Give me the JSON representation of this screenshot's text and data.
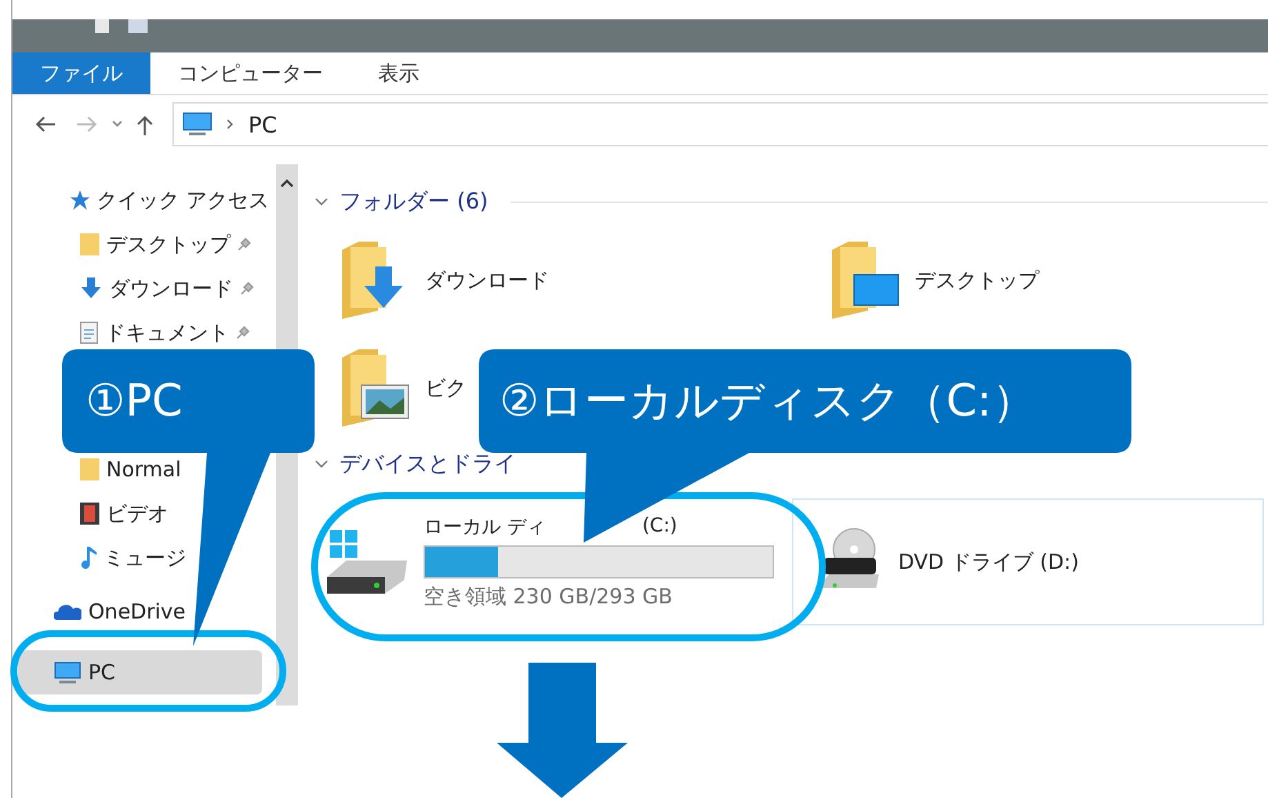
{
  "tabs": [
    {
      "label": "ファイル",
      "selected": true
    },
    {
      "label": "コンピューター",
      "selected": false
    },
    {
      "label": "表示",
      "selected": false
    }
  ],
  "address": {
    "path": "PC"
  },
  "nav": {
    "sections": [
      {
        "items": [
          {
            "label": "クイック アクセス",
            "kind": "star",
            "selected": false
          },
          {
            "label": "デスクトップ",
            "kind": "folder",
            "pinned": true,
            "selected": false
          },
          {
            "label": "ダウンロード",
            "kind": "download",
            "pinned": true,
            "selected": false
          },
          {
            "label": "ドキュメント",
            "kind": "document",
            "pinned": true,
            "selected": false
          }
        ]
      },
      {
        "items": [
          {
            "label": "Normal",
            "kind": "folder",
            "selected": false
          },
          {
            "label": "ビデオ",
            "kind": "video",
            "selected": false
          },
          {
            "label": "ミュージ",
            "kind": "music",
            "selected": false
          }
        ]
      },
      {
        "items": [
          {
            "label": "OneDrive",
            "kind": "cloud",
            "selected": false
          }
        ]
      },
      {
        "items": [
          {
            "label": "PC",
            "kind": "pc",
            "selected": true
          }
        ]
      }
    ]
  },
  "folders": {
    "heading": "フォルダー (6)",
    "items": [
      {
        "label": "ダウンロード",
        "kind": "download"
      },
      {
        "label": "デスクトップ",
        "kind": "desktop"
      },
      {
        "label": "ビク",
        "kind": "pictures"
      }
    ]
  },
  "devices": {
    "heading": "デバイスとドライ",
    "items": [
      {
        "kind": "disk",
        "name": "ローカル ディ",
        "name_end": "(C:)",
        "level": 0.21,
        "free": "空き領域 230 GB/293 GB",
        "selected": false
      },
      {
        "kind": "dvd",
        "name": "DVD ドライブ (D:)",
        "selected": true
      }
    ]
  },
  "callouts": [
    {
      "label": "①PC"
    },
    {
      "label": "②ローカルディスク（C:）"
    }
  ]
}
